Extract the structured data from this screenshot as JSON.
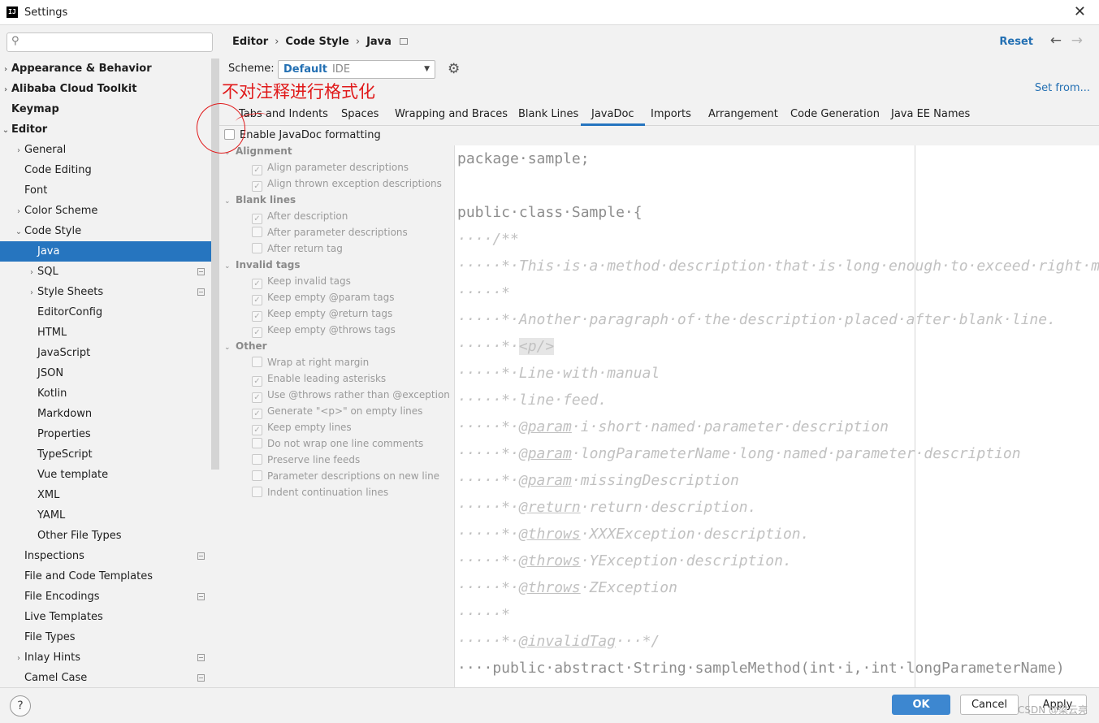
{
  "window": {
    "title": "Settings",
    "app_icon": "IJ"
  },
  "search": {
    "placeholder": ""
  },
  "sidebar": {
    "items": [
      {
        "label": "Appearance & Behavior",
        "indent": 0,
        "arrow": "›",
        "bold": true
      },
      {
        "label": "Alibaba Cloud Toolkit",
        "indent": 0,
        "arrow": "›",
        "bold": true
      },
      {
        "label": "Keymap",
        "indent": 0,
        "arrow": "",
        "bold": true
      },
      {
        "label": "Editor",
        "indent": 0,
        "arrow": "⌄",
        "bold": true
      },
      {
        "label": "General",
        "indent": 1,
        "arrow": "›"
      },
      {
        "label": "Code Editing",
        "indent": 1,
        "arrow": ""
      },
      {
        "label": "Font",
        "indent": 1,
        "arrow": ""
      },
      {
        "label": "Color Scheme",
        "indent": 1,
        "arrow": "›"
      },
      {
        "label": "Code Style",
        "indent": 1,
        "arrow": "⌄"
      },
      {
        "label": "Java",
        "indent": 2,
        "arrow": "",
        "selected": true
      },
      {
        "label": "SQL",
        "indent": 2,
        "arrow": "›",
        "project": true
      },
      {
        "label": "Style Sheets",
        "indent": 2,
        "arrow": "›",
        "project": true
      },
      {
        "label": "EditorConfig",
        "indent": 2,
        "arrow": ""
      },
      {
        "label": "HTML",
        "indent": 2,
        "arrow": ""
      },
      {
        "label": "JavaScript",
        "indent": 2,
        "arrow": ""
      },
      {
        "label": "JSON",
        "indent": 2,
        "arrow": ""
      },
      {
        "label": "Kotlin",
        "indent": 2,
        "arrow": ""
      },
      {
        "label": "Markdown",
        "indent": 2,
        "arrow": ""
      },
      {
        "label": "Properties",
        "indent": 2,
        "arrow": ""
      },
      {
        "label": "TypeScript",
        "indent": 2,
        "arrow": ""
      },
      {
        "label": "Vue template",
        "indent": 2,
        "arrow": ""
      },
      {
        "label": "XML",
        "indent": 2,
        "arrow": ""
      },
      {
        "label": "YAML",
        "indent": 2,
        "arrow": ""
      },
      {
        "label": "Other File Types",
        "indent": 2,
        "arrow": ""
      },
      {
        "label": "Inspections",
        "indent": 1,
        "arrow": "",
        "project": true
      },
      {
        "label": "File and Code Templates",
        "indent": 1,
        "arrow": ""
      },
      {
        "label": "File Encodings",
        "indent": 1,
        "arrow": "",
        "project": true
      },
      {
        "label": "Live Templates",
        "indent": 1,
        "arrow": ""
      },
      {
        "label": "File Types",
        "indent": 1,
        "arrow": ""
      },
      {
        "label": "Inlay Hints",
        "indent": 1,
        "arrow": "›",
        "project": true
      },
      {
        "label": "Camel Case",
        "indent": 1,
        "arrow": "",
        "project": true
      }
    ]
  },
  "header": {
    "breadcrumb": [
      "Editor",
      "Code Style",
      "Java"
    ],
    "separator": "›",
    "reset": "Reset",
    "back": "←",
    "forward": "→"
  },
  "scheme": {
    "label": "Scheme:",
    "value": "Default",
    "type": "IDE",
    "dropdown": "▼"
  },
  "gear": "⚙",
  "set_from": "Set from...",
  "annotation": "不对注释进行格式化",
  "tabs": [
    {
      "label": "Tabs and Indents"
    },
    {
      "label": "Spaces"
    },
    {
      "label": "Wrapping and Braces"
    },
    {
      "label": "Blank Lines"
    },
    {
      "label": "JavaDoc",
      "active": true
    },
    {
      "label": "Imports"
    },
    {
      "label": "Arrangement"
    },
    {
      "label": "Code Generation"
    },
    {
      "label": "Java EE Names"
    }
  ],
  "enable": {
    "label": "Enable JavaDoc formatting",
    "checked": false
  },
  "groups": [
    {
      "label": "Alignment",
      "arrow": "⌄",
      "options": [
        {
          "label": "Align parameter descriptions",
          "checked": true
        },
        {
          "label": "Align thrown exception descriptions",
          "checked": true
        }
      ]
    },
    {
      "label": "Blank lines",
      "arrow": "⌄",
      "options": [
        {
          "label": "After description",
          "checked": true
        },
        {
          "label": "After parameter descriptions",
          "checked": false
        },
        {
          "label": "After return tag",
          "checked": false
        }
      ]
    },
    {
      "label": "Invalid tags",
      "arrow": "⌄",
      "options": [
        {
          "label": "Keep invalid tags",
          "checked": true
        },
        {
          "label": "Keep empty @param tags",
          "checked": true
        },
        {
          "label": "Keep empty @return tags",
          "checked": true
        },
        {
          "label": "Keep empty @throws tags",
          "checked": true
        }
      ]
    },
    {
      "label": "Other",
      "arrow": "⌄",
      "options": [
        {
          "label": "Wrap at right margin",
          "checked": false
        },
        {
          "label": "Enable leading asterisks",
          "checked": true
        },
        {
          "label": "Use @throws rather than @exception",
          "checked": true
        },
        {
          "label": "Generate \"<p>\" on empty lines",
          "checked": true
        },
        {
          "label": "Keep empty lines",
          "checked": true
        },
        {
          "label": "Do not wrap one line comments",
          "checked": false
        },
        {
          "label": "Preserve line feeds",
          "checked": false
        },
        {
          "label": "Parameter descriptions on new line",
          "checked": false
        },
        {
          "label": "Indent continuation lines",
          "checked": false
        }
      ]
    }
  ],
  "preview": {
    "lines": [
      {
        "kind": "kw",
        "text": "package·sample;"
      },
      {
        "kind": "blank",
        "text": ""
      },
      {
        "kind": "kw",
        "text": "public·class·Sample·{"
      },
      {
        "kind": "cm",
        "text": "····/**"
      },
      {
        "kind": "cm",
        "text": "·····*·This·is·a·method·description·that·is·long·enough·to·exceed·right·margin."
      },
      {
        "kind": "cm",
        "text": "·····*"
      },
      {
        "kind": "cm",
        "text": "·····*·Another·paragraph·of·the·description·placed·after·blank·line."
      },
      {
        "kind": "cm",
        "text": "·····*·",
        "tag": "<p/>",
        "tagkind": "p"
      },
      {
        "kind": "cm",
        "text": "·····*·Line·with·manual"
      },
      {
        "kind": "cm",
        "text": "·····*·line·feed."
      },
      {
        "kind": "cm",
        "text": "·····*·",
        "tag": "@param",
        "rest": "·i·short·named·parameter·description"
      },
      {
        "kind": "cm",
        "text": "·····*·",
        "tag": "@param",
        "rest": "·longParameterName·long·named·parameter·description"
      },
      {
        "kind": "cm",
        "text": "·····*·",
        "tag": "@param",
        "rest": "·missingDescription"
      },
      {
        "kind": "cm",
        "text": "·····*·",
        "tag": "@return",
        "rest": "·return·description."
      },
      {
        "kind": "cm",
        "text": "·····*·",
        "tag": "@throws",
        "rest": "·XXXException·description."
      },
      {
        "kind": "cm",
        "text": "·····*·",
        "tag": "@throws",
        "rest": "·YException·description."
      },
      {
        "kind": "cm",
        "text": "·····*·",
        "tag": "@throws",
        "rest": "·ZException"
      },
      {
        "kind": "cm",
        "text": "·····*"
      },
      {
        "kind": "cm",
        "text": "·····*·",
        "tag": "@invalidTag",
        "rest": "···*/"
      },
      {
        "kind": "kw",
        "text": "····public·abstract·String·sampleMethod(int·i,·int·longParameterName)"
      }
    ]
  },
  "footer": {
    "help": "?",
    "ok": "OK",
    "cancel": "Cancel",
    "apply": "Apply",
    "watermark": "CSDN @梁云亮"
  }
}
